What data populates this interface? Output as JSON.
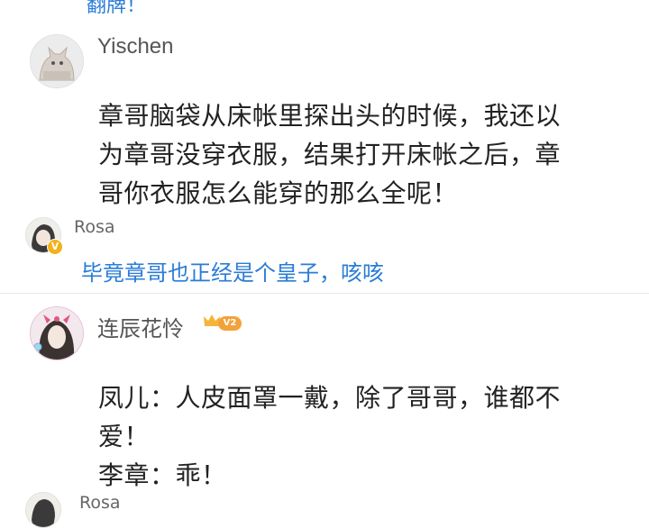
{
  "top_reply": {
    "text": "翻牌！"
  },
  "comments": [
    {
      "username": "Yischen",
      "avatar_icon": "cat-photo-avatar",
      "lines": [
        "章哥脑袋从床帐里探出头的时候，我还以",
        "为章哥没穿衣服，结果打开床帐之后，章",
        "哥你衣服怎么能穿的那么全呢！"
      ]
    },
    {
      "username": "连辰花怜",
      "avatar_icon": "anime-character-avatar",
      "level_badge": "V2",
      "lines": [
        "凤儿：人皮面罩一戴，除了哥哥，谁都不",
        "爱！",
        "李章：乖！"
      ]
    }
  ],
  "replies": [
    {
      "username": "Rosa",
      "verified_badge": "V",
      "text": "毕竟章哥也正经是个皇子，咳咳"
    },
    {
      "username": "Rosa"
    }
  ],
  "colors": {
    "link_blue": "#2a7cd6",
    "text": "#222222",
    "badge_orange": "#f3a23a"
  }
}
